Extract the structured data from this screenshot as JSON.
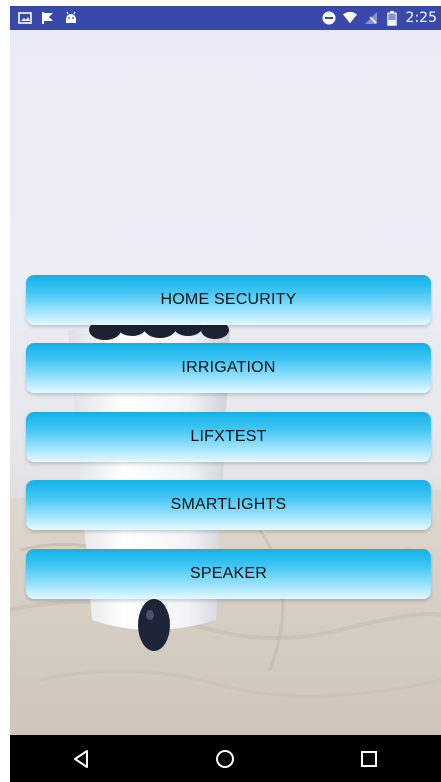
{
  "status_bar": {
    "time": "2:25",
    "left_icons": [
      "image-icon",
      "flag-icon",
      "android-icon"
    ],
    "right_icons": [
      "do-not-disturb-icon",
      "wifi-icon",
      "no-signal-icon",
      "battery-icon"
    ],
    "background_color": "#3949ab"
  },
  "menu": {
    "buttons": [
      {
        "label": "HOME SECURITY"
      },
      {
        "label": "IRRIGATION"
      },
      {
        "label": "LIFXTEST"
      },
      {
        "label": "SMARTLIGHTS"
      },
      {
        "label": "SPEAKER"
      }
    ],
    "accent_color": "#0fb2ea"
  },
  "nav_bar": {
    "icons": [
      "back-icon",
      "home-icon",
      "recents-icon"
    ]
  }
}
